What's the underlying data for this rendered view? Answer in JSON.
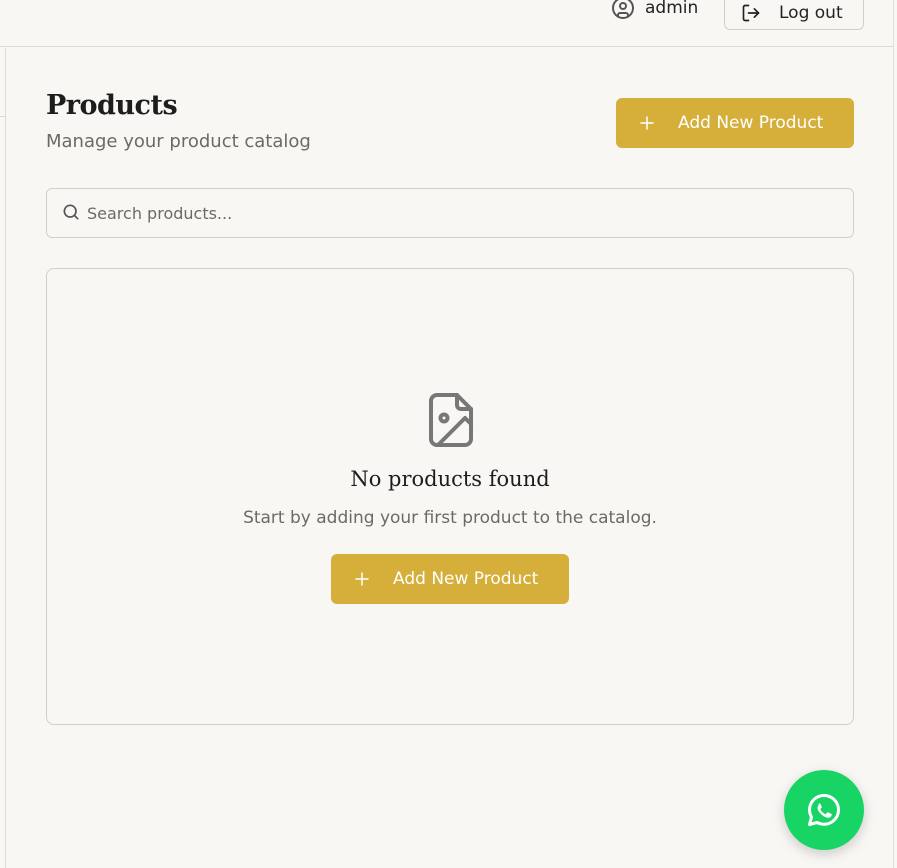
{
  "header": {
    "username": "admin",
    "logout_label": "Log out"
  },
  "page": {
    "title": "Products",
    "subtitle": "Manage your product catalog",
    "add_button_label": "Add New Product"
  },
  "search": {
    "placeholder": "Search products...",
    "value": ""
  },
  "empty_state": {
    "title": "No products found",
    "message": "Start by adding your first product to the catalog.",
    "button_label": "Add New Product"
  },
  "icons": {
    "user": "user-circle-icon",
    "logout": "log-out-icon",
    "plus": "plus-icon",
    "search": "search-icon",
    "empty": "file-image-icon",
    "whatsapp": "whatsapp-icon"
  },
  "colors": {
    "accent": "#d6af3a",
    "background": "#f9f7f4",
    "whatsapp": "#17d465"
  }
}
